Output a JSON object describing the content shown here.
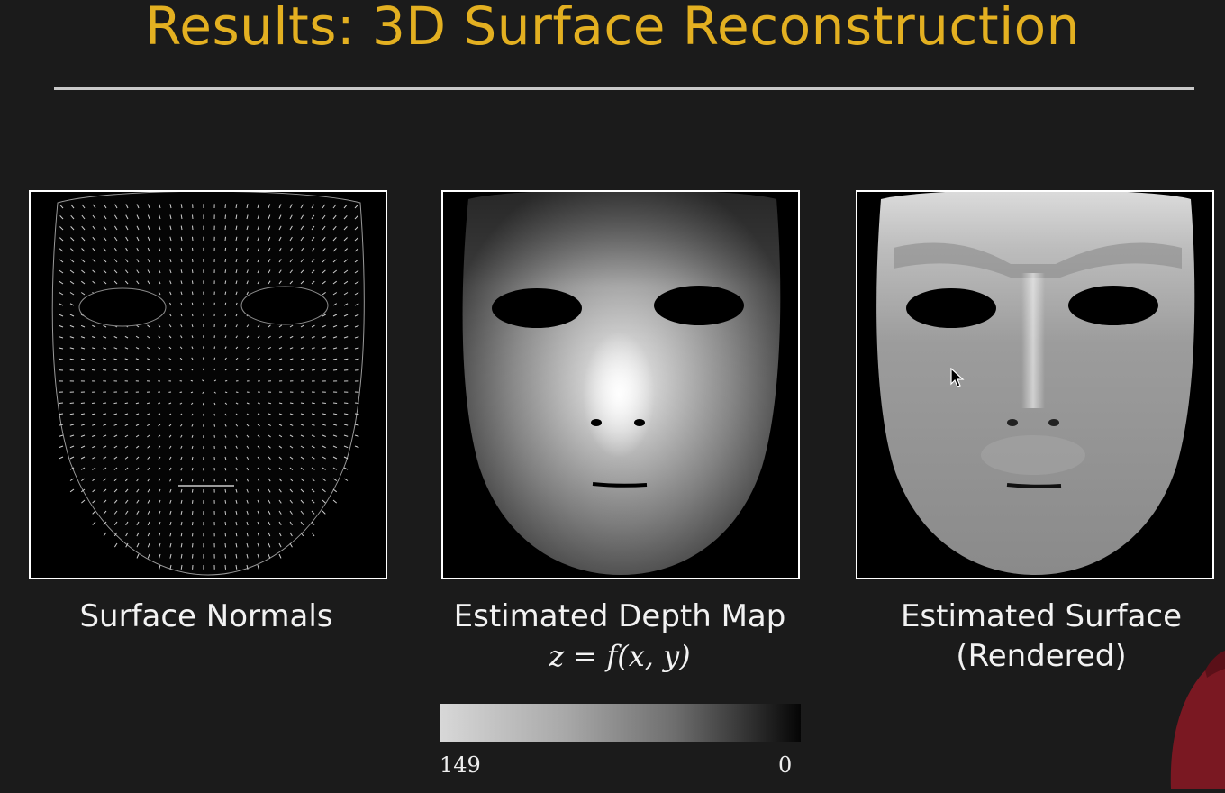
{
  "slide": {
    "title": "Results: 3D Surface Reconstruction",
    "colors": {
      "title": "#e3b021",
      "background": "#1b1b1b",
      "text": "#f2f2f2"
    }
  },
  "panels": [
    {
      "caption": "Surface Normals",
      "image": "face-normals-needle-map"
    },
    {
      "caption": "Estimated Depth Map",
      "formula": "z = f(x, y)",
      "image": "face-depth-map"
    },
    {
      "caption_line1": "Estimated Surface",
      "caption_line2": "(Rendered)",
      "image": "face-rendered-surface"
    }
  ],
  "colorbar": {
    "max_label": "149",
    "min_label": "0"
  },
  "overlay": {
    "cursor_icon": "mouse-pointer-icon",
    "presenter": "presenter-silhouette"
  }
}
